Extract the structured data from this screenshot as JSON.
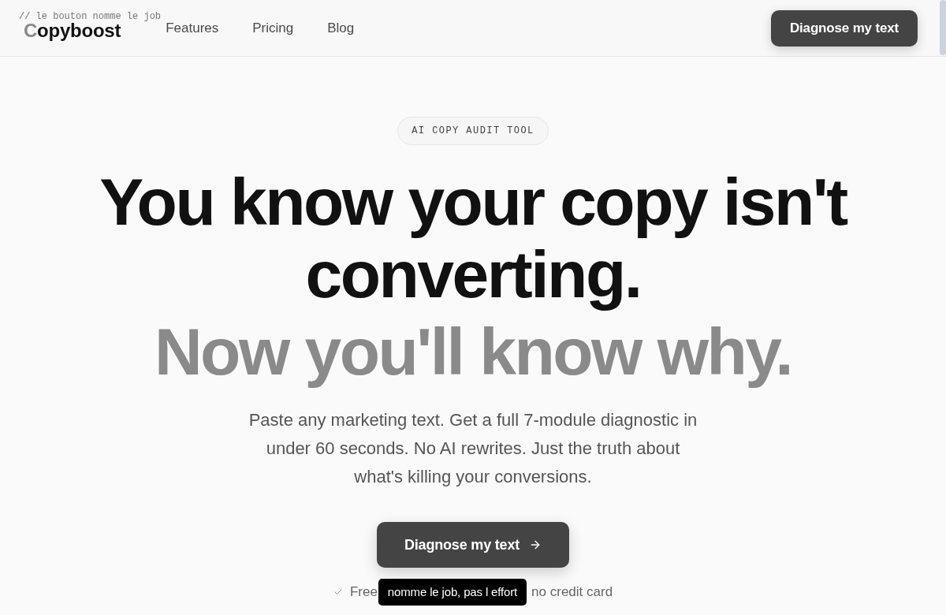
{
  "annotation": "// le bouton nomme le job",
  "header": {
    "logo": {
      "lead": "C",
      "rest": "opyboost"
    },
    "nav": [
      "Features",
      "Pricing",
      "Blog"
    ],
    "cta": "Diagnose my text"
  },
  "hero": {
    "badge": "AI COPY AUDIT TOOL",
    "headline": "You know your copy isn't converting.",
    "headline_accent": "Now you'll know why.",
    "subtext": "Paste any marketing text. Get a full 7-module diagnostic in under 60 seconds. No AI rewrites. Just the truth about what's killing your conversions.",
    "cta": "Diagnose my text",
    "note": {
      "before": "Free",
      "after": "no credit card"
    },
    "tooltip": "nomme le job, pas l effort"
  }
}
